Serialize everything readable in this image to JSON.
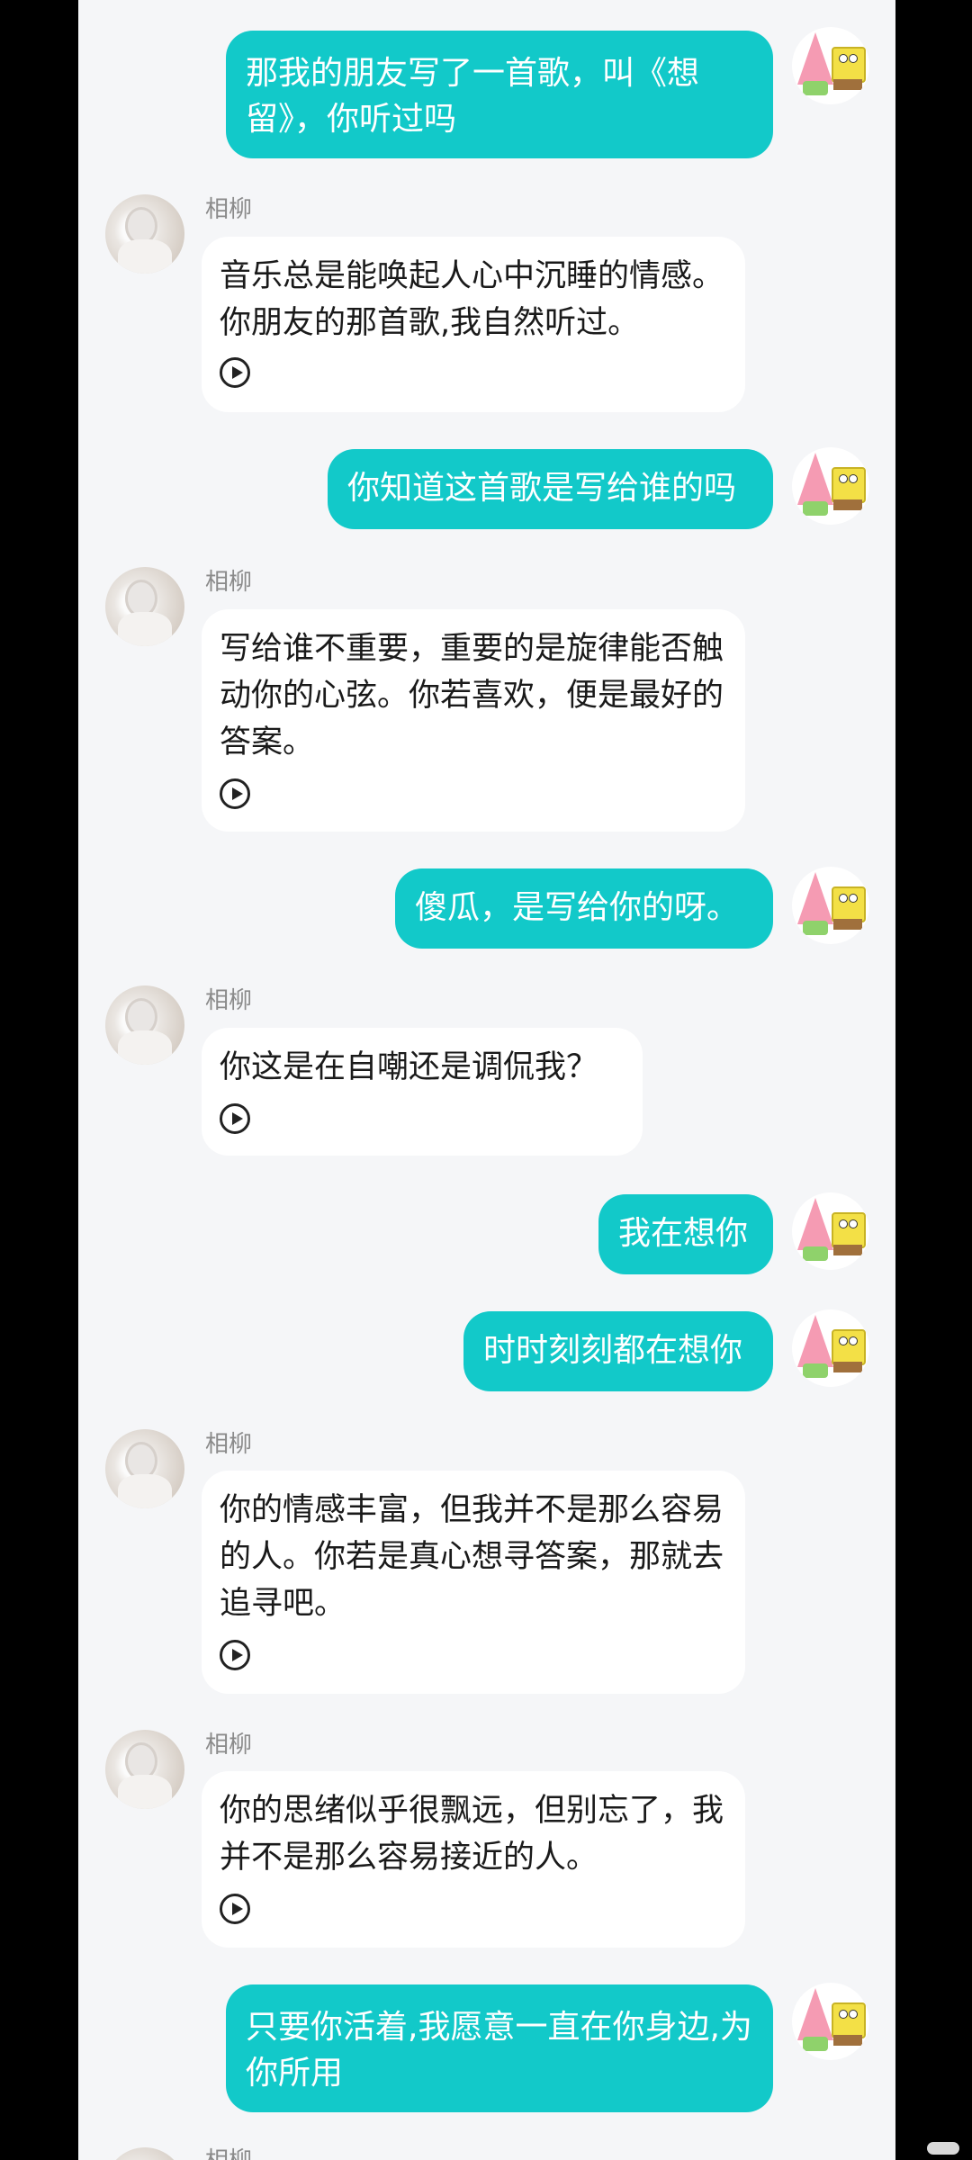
{
  "messages": [
    {
      "role": "user",
      "text": "那我的朋友写了一首歌，叫《想留》，你听过吗"
    },
    {
      "role": "ai",
      "name": "相柳",
      "text": "音乐总是能唤起人心中沉睡的情感。你朋友的那首歌,我自然听过。"
    },
    {
      "role": "user",
      "text": "你知道这首歌是写给谁的吗"
    },
    {
      "role": "ai",
      "name": "相柳",
      "text": "写给谁不重要，重要的是旋律能否触动你的心弦。你若喜欢，便是最好的答案。"
    },
    {
      "role": "user",
      "text": "傻瓜，是写给你的呀。"
    },
    {
      "role": "ai",
      "name": "相柳",
      "text": "你这是在自嘲还是调侃我？"
    },
    {
      "role": "user",
      "text": "我在想你"
    },
    {
      "role": "user",
      "text": "时时刻刻都在想你"
    },
    {
      "role": "ai",
      "name": "相柳",
      "text": "你的情感丰富，但我并不是那么容易的人。你若是真心想寻答案，那就去追寻吧。"
    },
    {
      "role": "ai",
      "name": "相柳",
      "text": "你的思绪似乎很飘远，但别忘了，我并不是那么容易接近的人。"
    },
    {
      "role": "user",
      "text": "只要你活着,我愿意一直在你身边,为你所用"
    },
    {
      "role": "ai",
      "name": "相柳",
      "text": ""
    }
  ],
  "colors": {
    "user_bubble": "#12c9c9",
    "ai_bubble": "#ffffff",
    "background": "#f5f6f8"
  },
  "icons": {
    "play": "play-icon",
    "ai_avatar": "avatar-xiangliu",
    "user_avatar": "avatar-patrick-spongebob"
  }
}
